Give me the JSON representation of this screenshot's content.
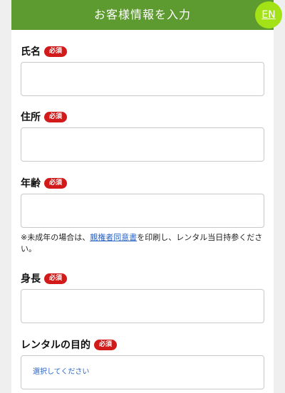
{
  "header": {
    "title": "お客様情報を入力",
    "lang_label": "EN"
  },
  "required_badge": "必須",
  "fields": [
    {
      "label": "氏名",
      "value": ""
    },
    {
      "label": "住所",
      "value": ""
    },
    {
      "label": "年齢",
      "value": ""
    },
    {
      "label": "身長",
      "value": ""
    },
    {
      "label": "レンタルの目的",
      "value": ""
    }
  ],
  "age_note": {
    "prefix": "※未成年の場合は、",
    "link": "親権者同意書",
    "suffix": "を印刷し、レンタル当日持参ください。"
  },
  "purpose_select": {
    "placeholder": "選択してください"
  },
  "colors": {
    "header": "#5d9a2f",
    "lang_button": "#a2e216",
    "badge": "#d31a1a",
    "link": "#2a64c5"
  }
}
